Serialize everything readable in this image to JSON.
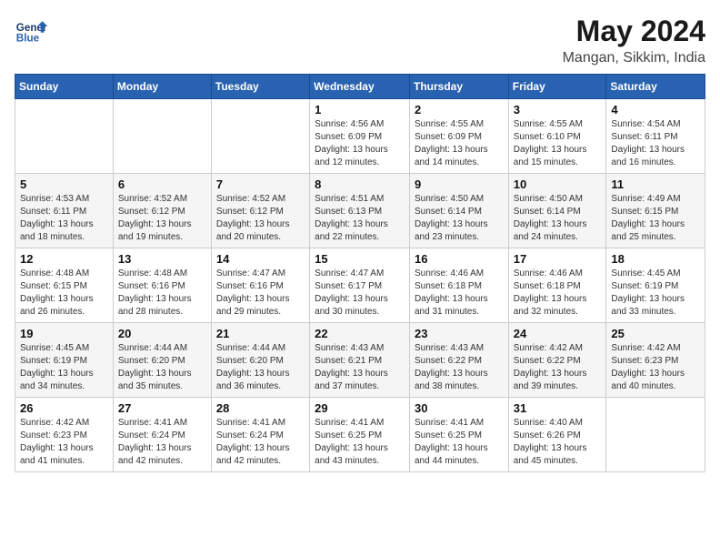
{
  "header": {
    "logo_line1": "General",
    "logo_line2": "Blue",
    "month": "May 2024",
    "location": "Mangan, Sikkim, India"
  },
  "days_of_week": [
    "Sunday",
    "Monday",
    "Tuesday",
    "Wednesday",
    "Thursday",
    "Friday",
    "Saturday"
  ],
  "weeks": [
    [
      {
        "day": "",
        "info": ""
      },
      {
        "day": "",
        "info": ""
      },
      {
        "day": "",
        "info": ""
      },
      {
        "day": "1",
        "info": "Sunrise: 4:56 AM\nSunset: 6:09 PM\nDaylight: 13 hours\nand 12 minutes."
      },
      {
        "day": "2",
        "info": "Sunrise: 4:55 AM\nSunset: 6:09 PM\nDaylight: 13 hours\nand 14 minutes."
      },
      {
        "day": "3",
        "info": "Sunrise: 4:55 AM\nSunset: 6:10 PM\nDaylight: 13 hours\nand 15 minutes."
      },
      {
        "day": "4",
        "info": "Sunrise: 4:54 AM\nSunset: 6:11 PM\nDaylight: 13 hours\nand 16 minutes."
      }
    ],
    [
      {
        "day": "5",
        "info": "Sunrise: 4:53 AM\nSunset: 6:11 PM\nDaylight: 13 hours\nand 18 minutes."
      },
      {
        "day": "6",
        "info": "Sunrise: 4:52 AM\nSunset: 6:12 PM\nDaylight: 13 hours\nand 19 minutes."
      },
      {
        "day": "7",
        "info": "Sunrise: 4:52 AM\nSunset: 6:12 PM\nDaylight: 13 hours\nand 20 minutes."
      },
      {
        "day": "8",
        "info": "Sunrise: 4:51 AM\nSunset: 6:13 PM\nDaylight: 13 hours\nand 22 minutes."
      },
      {
        "day": "9",
        "info": "Sunrise: 4:50 AM\nSunset: 6:14 PM\nDaylight: 13 hours\nand 23 minutes."
      },
      {
        "day": "10",
        "info": "Sunrise: 4:50 AM\nSunset: 6:14 PM\nDaylight: 13 hours\nand 24 minutes."
      },
      {
        "day": "11",
        "info": "Sunrise: 4:49 AM\nSunset: 6:15 PM\nDaylight: 13 hours\nand 25 minutes."
      }
    ],
    [
      {
        "day": "12",
        "info": "Sunrise: 4:48 AM\nSunset: 6:15 PM\nDaylight: 13 hours\nand 26 minutes."
      },
      {
        "day": "13",
        "info": "Sunrise: 4:48 AM\nSunset: 6:16 PM\nDaylight: 13 hours\nand 28 minutes."
      },
      {
        "day": "14",
        "info": "Sunrise: 4:47 AM\nSunset: 6:16 PM\nDaylight: 13 hours\nand 29 minutes."
      },
      {
        "day": "15",
        "info": "Sunrise: 4:47 AM\nSunset: 6:17 PM\nDaylight: 13 hours\nand 30 minutes."
      },
      {
        "day": "16",
        "info": "Sunrise: 4:46 AM\nSunset: 6:18 PM\nDaylight: 13 hours\nand 31 minutes."
      },
      {
        "day": "17",
        "info": "Sunrise: 4:46 AM\nSunset: 6:18 PM\nDaylight: 13 hours\nand 32 minutes."
      },
      {
        "day": "18",
        "info": "Sunrise: 4:45 AM\nSunset: 6:19 PM\nDaylight: 13 hours\nand 33 minutes."
      }
    ],
    [
      {
        "day": "19",
        "info": "Sunrise: 4:45 AM\nSunset: 6:19 PM\nDaylight: 13 hours\nand 34 minutes."
      },
      {
        "day": "20",
        "info": "Sunrise: 4:44 AM\nSunset: 6:20 PM\nDaylight: 13 hours\nand 35 minutes."
      },
      {
        "day": "21",
        "info": "Sunrise: 4:44 AM\nSunset: 6:20 PM\nDaylight: 13 hours\nand 36 minutes."
      },
      {
        "day": "22",
        "info": "Sunrise: 4:43 AM\nSunset: 6:21 PM\nDaylight: 13 hours\nand 37 minutes."
      },
      {
        "day": "23",
        "info": "Sunrise: 4:43 AM\nSunset: 6:22 PM\nDaylight: 13 hours\nand 38 minutes."
      },
      {
        "day": "24",
        "info": "Sunrise: 4:42 AM\nSunset: 6:22 PM\nDaylight: 13 hours\nand 39 minutes."
      },
      {
        "day": "25",
        "info": "Sunrise: 4:42 AM\nSunset: 6:23 PM\nDaylight: 13 hours\nand 40 minutes."
      }
    ],
    [
      {
        "day": "26",
        "info": "Sunrise: 4:42 AM\nSunset: 6:23 PM\nDaylight: 13 hours\nand 41 minutes."
      },
      {
        "day": "27",
        "info": "Sunrise: 4:41 AM\nSunset: 6:24 PM\nDaylight: 13 hours\nand 42 minutes."
      },
      {
        "day": "28",
        "info": "Sunrise: 4:41 AM\nSunset: 6:24 PM\nDaylight: 13 hours\nand 42 minutes."
      },
      {
        "day": "29",
        "info": "Sunrise: 4:41 AM\nSunset: 6:25 PM\nDaylight: 13 hours\nand 43 minutes."
      },
      {
        "day": "30",
        "info": "Sunrise: 4:41 AM\nSunset: 6:25 PM\nDaylight: 13 hours\nand 44 minutes."
      },
      {
        "day": "31",
        "info": "Sunrise: 4:40 AM\nSunset: 6:26 PM\nDaylight: 13 hours\nand 45 minutes."
      },
      {
        "day": "",
        "info": ""
      }
    ]
  ]
}
